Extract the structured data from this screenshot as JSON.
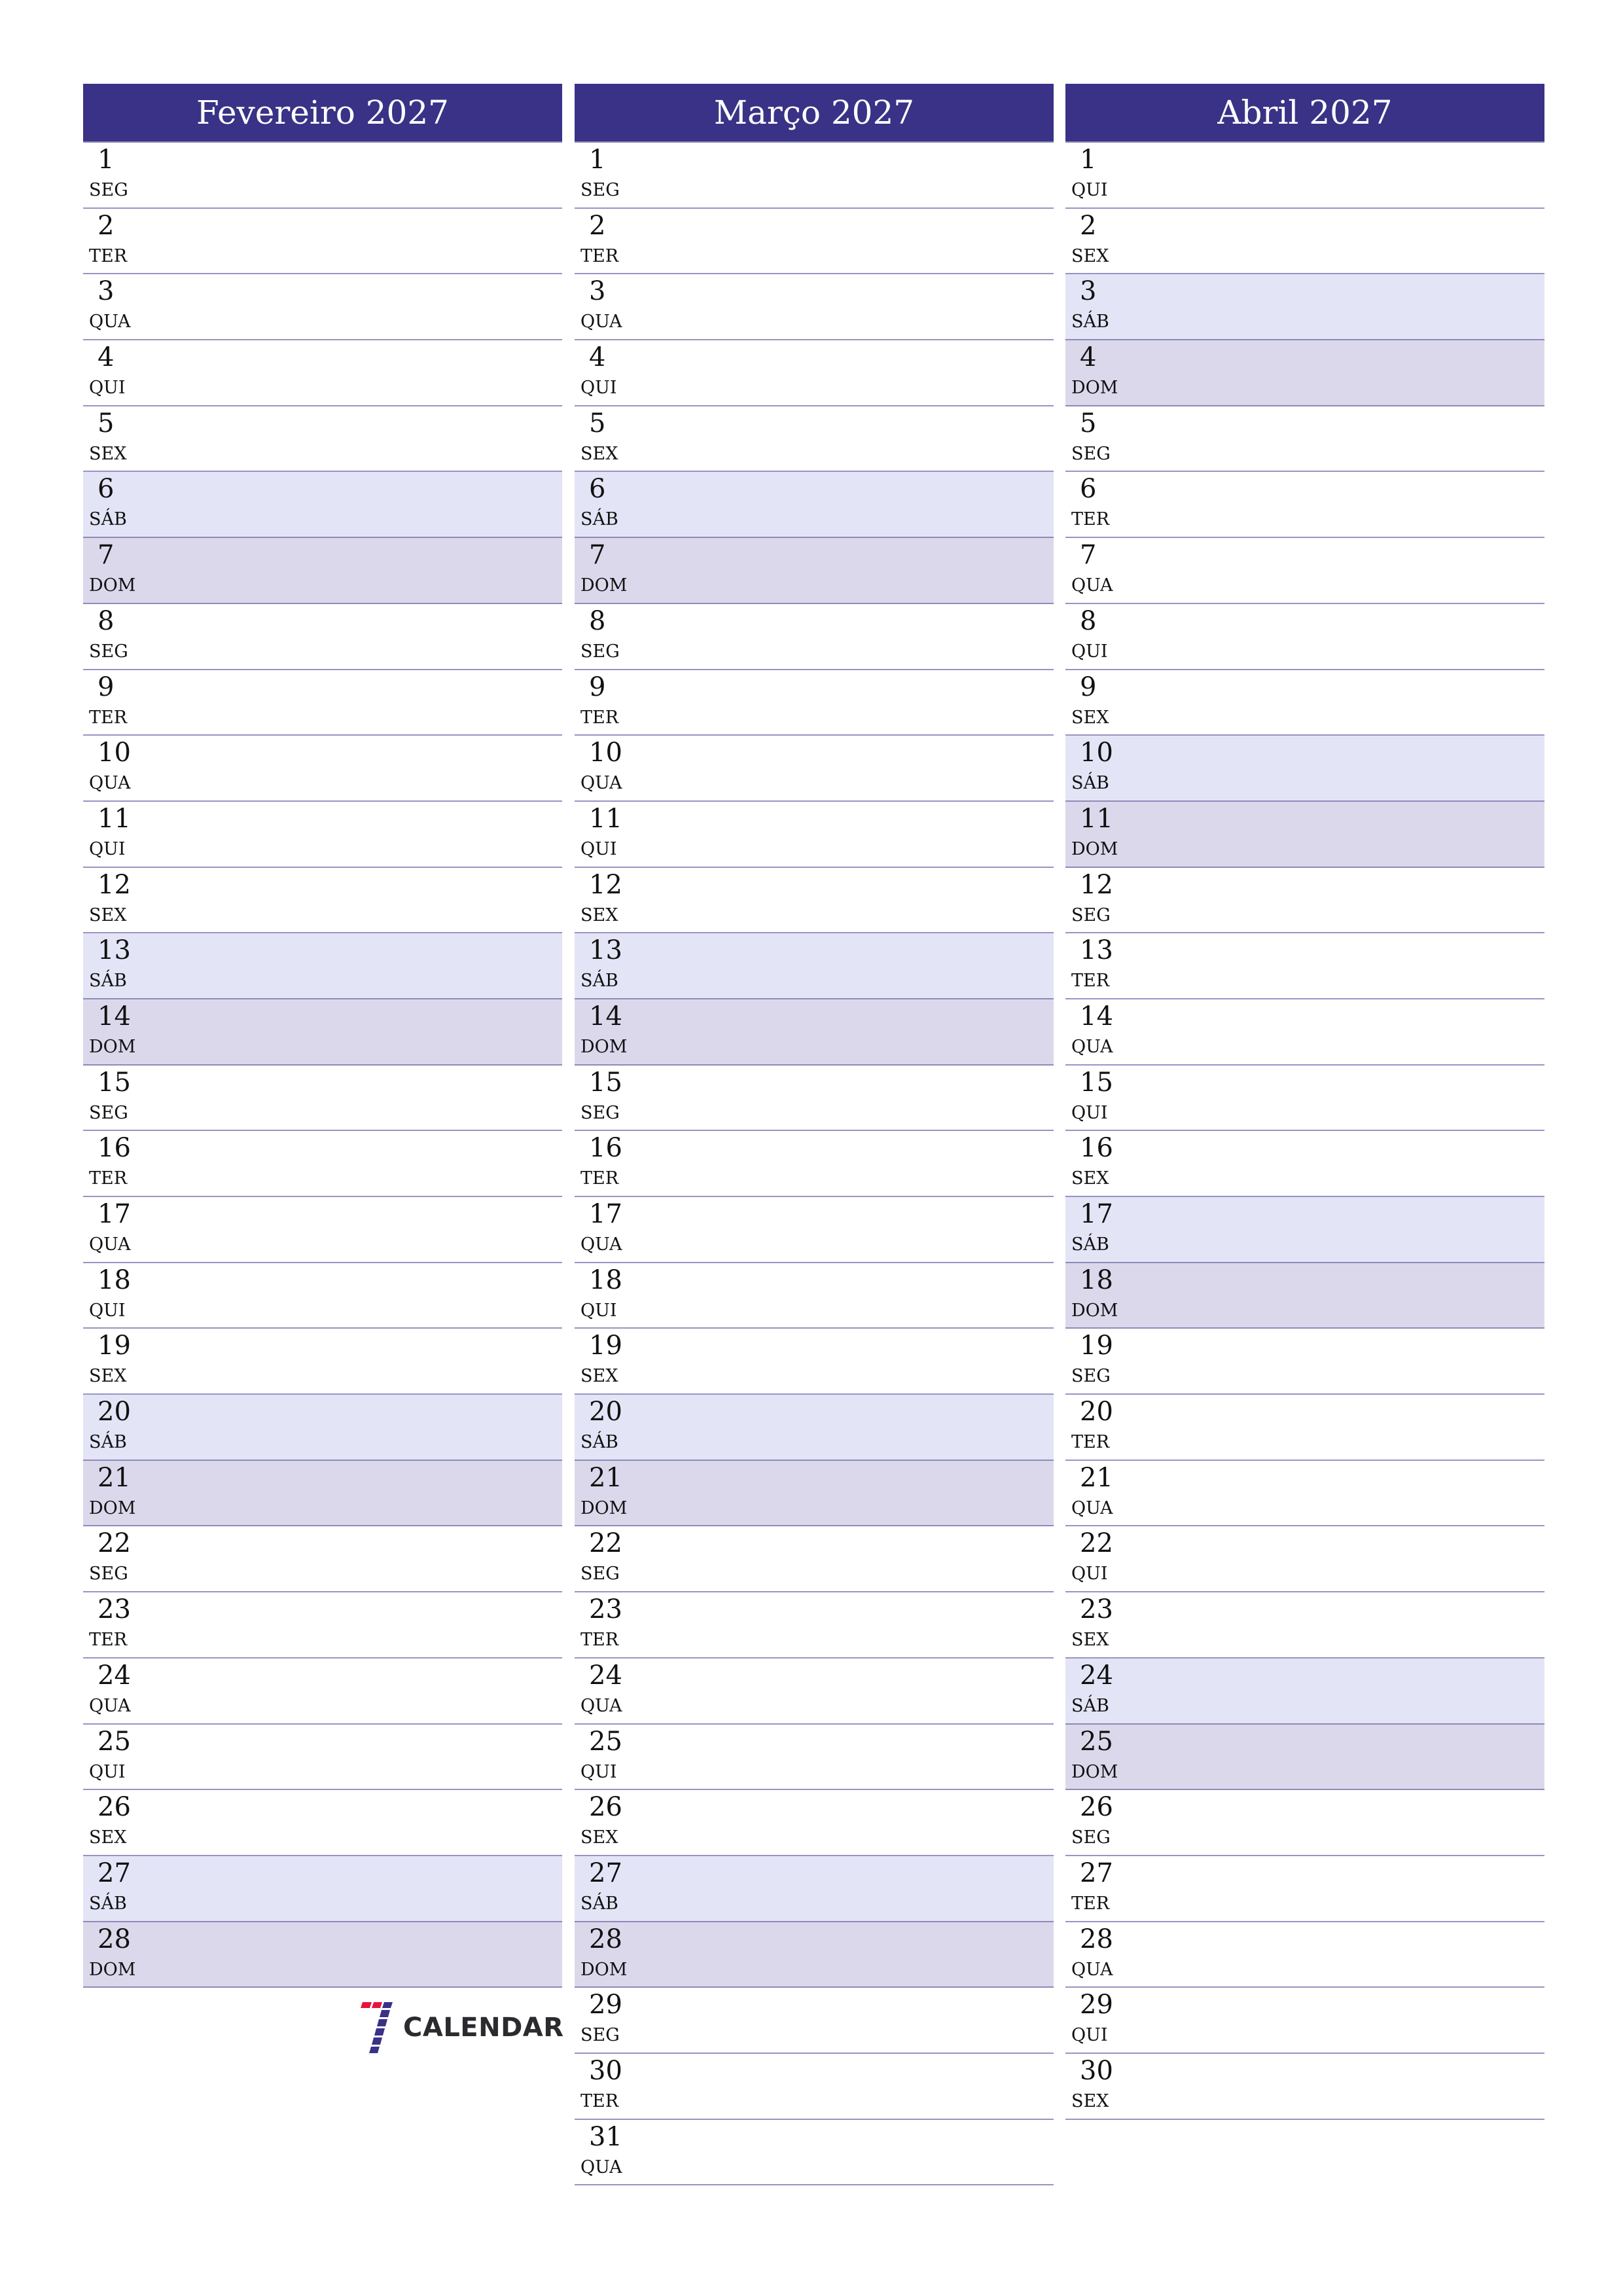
{
  "colors": {
    "header_bg": "#3a3286",
    "header_text": "#ffffff",
    "saturday_bg": "#e4e4f7",
    "sunday_bg": "#dcd8ec",
    "row_line": "#9894c4",
    "logo_red": "#e8133d",
    "logo_navy": "#3a3286"
  },
  "months": [
    {
      "title": "Fevereiro 2027",
      "days": [
        {
          "n": "1",
          "d": "SEG"
        },
        {
          "n": "2",
          "d": "TER"
        },
        {
          "n": "3",
          "d": "QUA"
        },
        {
          "n": "4",
          "d": "QUI"
        },
        {
          "n": "5",
          "d": "SEX"
        },
        {
          "n": "6",
          "d": "SÁB"
        },
        {
          "n": "7",
          "d": "DOM"
        },
        {
          "n": "8",
          "d": "SEG"
        },
        {
          "n": "9",
          "d": "TER"
        },
        {
          "n": "10",
          "d": "QUA"
        },
        {
          "n": "11",
          "d": "QUI"
        },
        {
          "n": "12",
          "d": "SEX"
        },
        {
          "n": "13",
          "d": "SÁB"
        },
        {
          "n": "14",
          "d": "DOM"
        },
        {
          "n": "15",
          "d": "SEG"
        },
        {
          "n": "16",
          "d": "TER"
        },
        {
          "n": "17",
          "d": "QUA"
        },
        {
          "n": "18",
          "d": "QUI"
        },
        {
          "n": "19",
          "d": "SEX"
        },
        {
          "n": "20",
          "d": "SÁB"
        },
        {
          "n": "21",
          "d": "DOM"
        },
        {
          "n": "22",
          "d": "SEG"
        },
        {
          "n": "23",
          "d": "TER"
        },
        {
          "n": "24",
          "d": "QUA"
        },
        {
          "n": "25",
          "d": "QUI"
        },
        {
          "n": "26",
          "d": "SEX"
        },
        {
          "n": "27",
          "d": "SÁB"
        },
        {
          "n": "28",
          "d": "DOM"
        }
      ]
    },
    {
      "title": "Março 2027",
      "days": [
        {
          "n": "1",
          "d": "SEG"
        },
        {
          "n": "2",
          "d": "TER"
        },
        {
          "n": "3",
          "d": "QUA"
        },
        {
          "n": "4",
          "d": "QUI"
        },
        {
          "n": "5",
          "d": "SEX"
        },
        {
          "n": "6",
          "d": "SÁB"
        },
        {
          "n": "7",
          "d": "DOM"
        },
        {
          "n": "8",
          "d": "SEG"
        },
        {
          "n": "9",
          "d": "TER"
        },
        {
          "n": "10",
          "d": "QUA"
        },
        {
          "n": "11",
          "d": "QUI"
        },
        {
          "n": "12",
          "d": "SEX"
        },
        {
          "n": "13",
          "d": "SÁB"
        },
        {
          "n": "14",
          "d": "DOM"
        },
        {
          "n": "15",
          "d": "SEG"
        },
        {
          "n": "16",
          "d": "TER"
        },
        {
          "n": "17",
          "d": "QUA"
        },
        {
          "n": "18",
          "d": "QUI"
        },
        {
          "n": "19",
          "d": "SEX"
        },
        {
          "n": "20",
          "d": "SÁB"
        },
        {
          "n": "21",
          "d": "DOM"
        },
        {
          "n": "22",
          "d": "SEG"
        },
        {
          "n": "23",
          "d": "TER"
        },
        {
          "n": "24",
          "d": "QUA"
        },
        {
          "n": "25",
          "d": "QUI"
        },
        {
          "n": "26",
          "d": "SEX"
        },
        {
          "n": "27",
          "d": "SÁB"
        },
        {
          "n": "28",
          "d": "DOM"
        },
        {
          "n": "29",
          "d": "SEG"
        },
        {
          "n": "30",
          "d": "TER"
        },
        {
          "n": "31",
          "d": "QUA"
        }
      ]
    },
    {
      "title": "Abril 2027",
      "days": [
        {
          "n": "1",
          "d": "QUI"
        },
        {
          "n": "2",
          "d": "SEX"
        },
        {
          "n": "3",
          "d": "SÁB"
        },
        {
          "n": "4",
          "d": "DOM"
        },
        {
          "n": "5",
          "d": "SEG"
        },
        {
          "n": "6",
          "d": "TER"
        },
        {
          "n": "7",
          "d": "QUA"
        },
        {
          "n": "8",
          "d": "QUI"
        },
        {
          "n": "9",
          "d": "SEX"
        },
        {
          "n": "10",
          "d": "SÁB"
        },
        {
          "n": "11",
          "d": "DOM"
        },
        {
          "n": "12",
          "d": "SEG"
        },
        {
          "n": "13",
          "d": "TER"
        },
        {
          "n": "14",
          "d": "QUA"
        },
        {
          "n": "15",
          "d": "QUI"
        },
        {
          "n": "16",
          "d": "SEX"
        },
        {
          "n": "17",
          "d": "SÁB"
        },
        {
          "n": "18",
          "d": "DOM"
        },
        {
          "n": "19",
          "d": "SEG"
        },
        {
          "n": "20",
          "d": "TER"
        },
        {
          "n": "21",
          "d": "QUA"
        },
        {
          "n": "22",
          "d": "QUI"
        },
        {
          "n": "23",
          "d": "SEX"
        },
        {
          "n": "24",
          "d": "SÁB"
        },
        {
          "n": "25",
          "d": "DOM"
        },
        {
          "n": "26",
          "d": "SEG"
        },
        {
          "n": "27",
          "d": "TER"
        },
        {
          "n": "28",
          "d": "QUA"
        },
        {
          "n": "29",
          "d": "QUI"
        },
        {
          "n": "30",
          "d": "SEX"
        }
      ]
    }
  ],
  "weekend": {
    "saturday": "SÁB",
    "sunday": "DOM"
  },
  "logo": {
    "icon": "seven-calendar-logo-icon",
    "text": "CALENDAR"
  }
}
